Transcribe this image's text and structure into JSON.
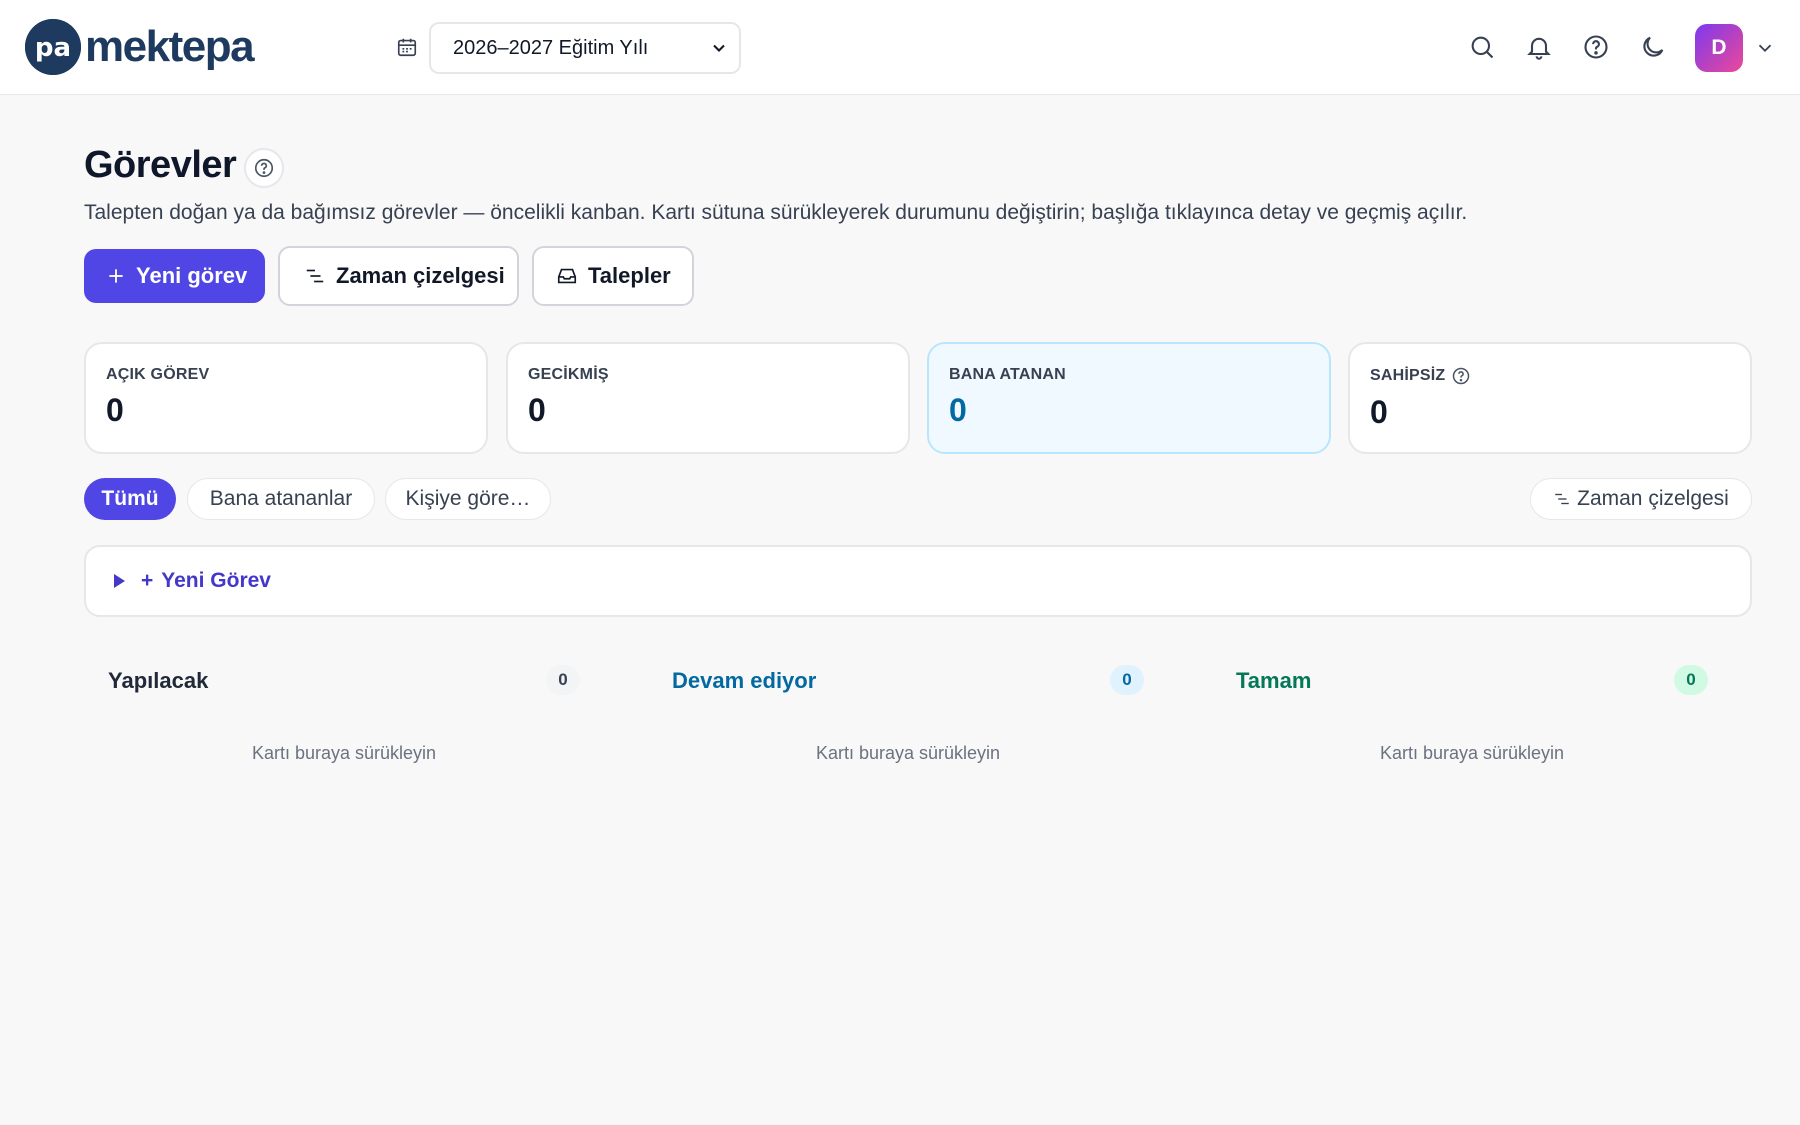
{
  "app": {
    "brand": "mektepa"
  },
  "header": {
    "school_year": "2026–2027 Eğitim Yılı",
    "avatar_initial": "D"
  },
  "page": {
    "title": "Görevler",
    "subtitle": "Talepten doğan ya da bağımsız görevler — öncelikli kanban. Kartı sütuna sürükleyerek durumunu değiştirin; başlığa tıklayınca detay ve geçmiş açılır."
  },
  "actions": {
    "new_task": "Yeni görev",
    "timeline": "Zaman çizelgesi",
    "requests": "Talepler"
  },
  "stats": [
    {
      "label": "AÇIK GÖREV",
      "value": "0"
    },
    {
      "label": "GECİKMİŞ",
      "value": "0"
    },
    {
      "label": "BANA ATANAN",
      "value": "0"
    },
    {
      "label": "SAHİPSİZ",
      "value": "0"
    }
  ],
  "filters": {
    "all": "Tümü",
    "assigned_to_me": "Bana atananlar",
    "by_person": "Kişiye göre…",
    "timeline": "Zaman çizelgesi"
  },
  "new_task_panel": {
    "label": "Yeni Görev"
  },
  "columns": [
    {
      "title": "Yapılacak",
      "count": "0",
      "empty": "Kartı buraya sürükleyin"
    },
    {
      "title": "Devam ediyor",
      "count": "0",
      "empty": "Kartı buraya sürükleyin"
    },
    {
      "title": "Tamam",
      "count": "0",
      "empty": "Kartı buraya sürükleyin"
    }
  ],
  "colors": {
    "primary": "#4f46e5",
    "brand": "#1e3a5f",
    "in_progress": "#0369a1",
    "done": "#047857"
  }
}
